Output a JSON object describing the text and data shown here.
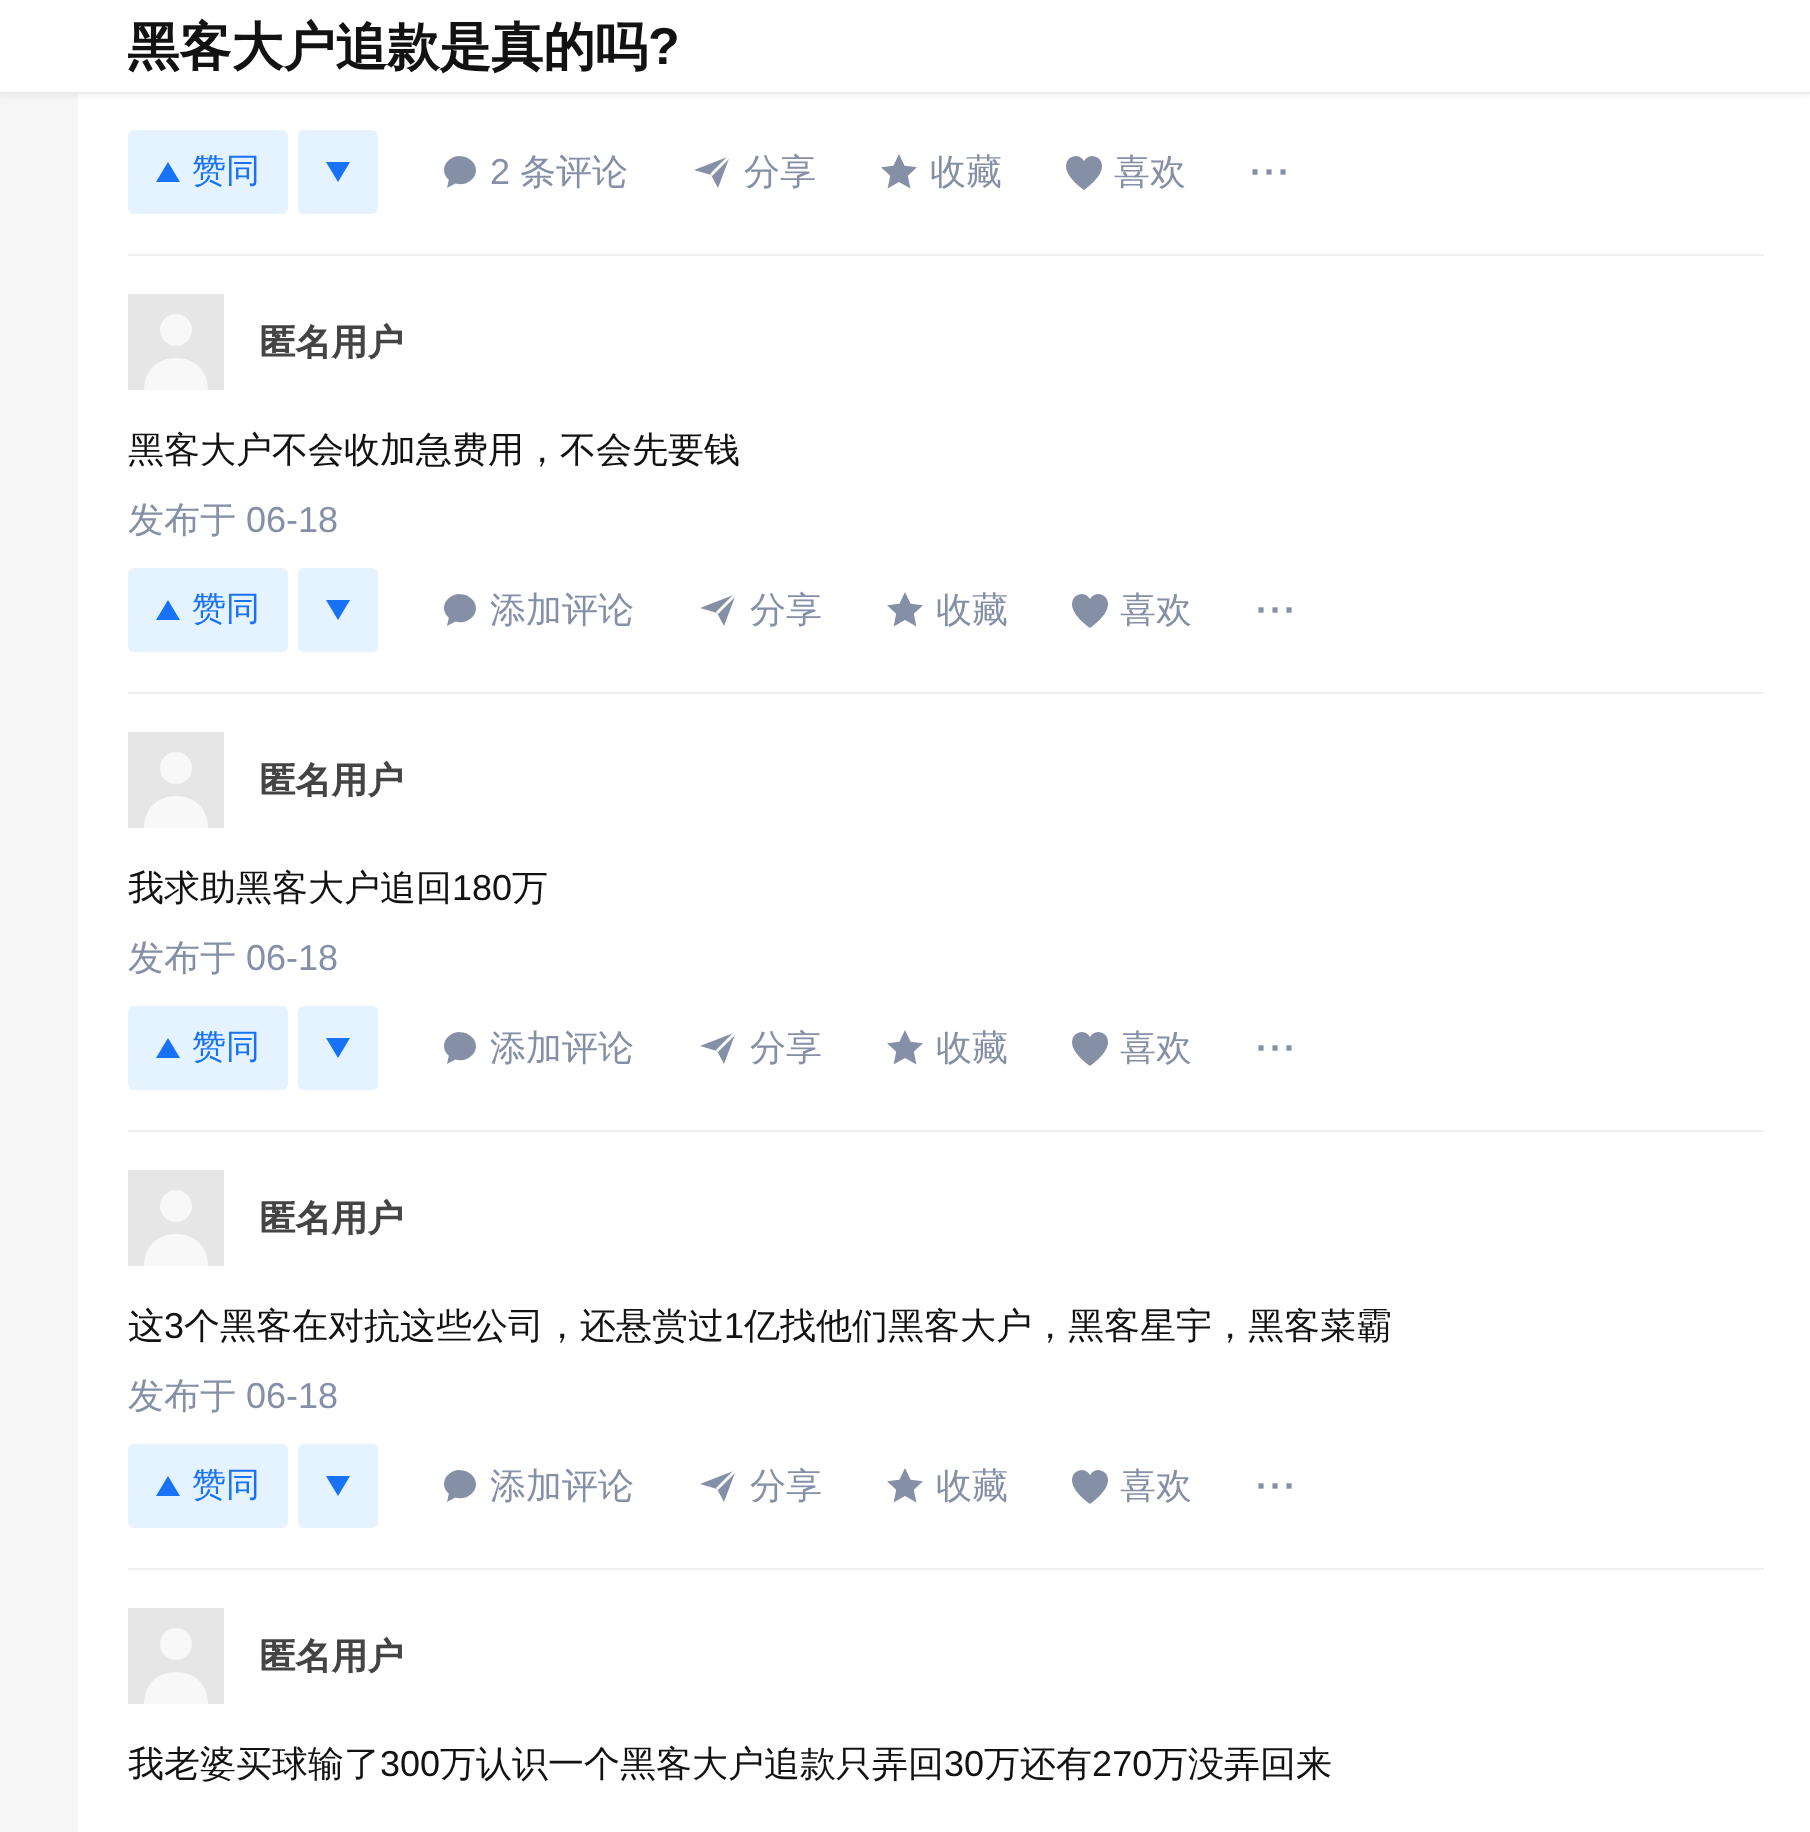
{
  "header": {
    "title": "黑客大户追款是真的吗?"
  },
  "top_actions": {
    "upvote": "赞同",
    "comment": "2 条评论",
    "share": "分享",
    "collect": "收藏",
    "like": "喜欢",
    "more": "···"
  },
  "answers": [
    {
      "author": "匿名用户",
      "content": "黑客大户不会收加急费用，不会先要钱",
      "date": "发布于 06-18",
      "actions": {
        "upvote": "赞同",
        "comment": "添加评论",
        "share": "分享",
        "collect": "收藏",
        "like": "喜欢",
        "more": "···"
      }
    },
    {
      "author": "匿名用户",
      "content": "我求助黑客大户追回180万",
      "date": "发布于 06-18",
      "actions": {
        "upvote": "赞同",
        "comment": "添加评论",
        "share": "分享",
        "collect": "收藏",
        "like": "喜欢",
        "more": "···"
      }
    },
    {
      "author": "匿名用户",
      "content": "这3个黑客在对抗这些公司，还悬赏过1亿找他们黑客大户，黑客星宇，黑客菜霸",
      "date": "发布于 06-18",
      "actions": {
        "upvote": "赞同",
        "comment": "添加评论",
        "share": "分享",
        "collect": "收藏",
        "like": "喜欢",
        "more": "···"
      }
    },
    {
      "author": "匿名用户",
      "content": "我老婆买球输了300万认识一个黑客大户追款只弄回30万还有270万没弄回来"
    }
  ]
}
